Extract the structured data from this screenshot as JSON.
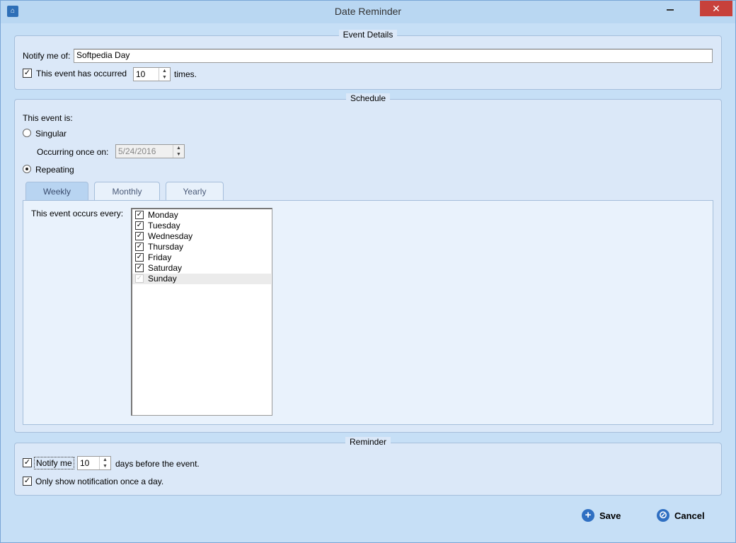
{
  "window": {
    "title": "Date Reminder"
  },
  "event_details": {
    "heading": "Event Details",
    "notify_label": "Notify me of:",
    "notify_value": "Softpedia Day",
    "occurred_label": "This event has occurred",
    "occurred_checked": true,
    "occurred_count": "10",
    "times_label": "times."
  },
  "schedule": {
    "heading": "Schedule",
    "event_is_label": "This event is:",
    "singular_label": "Singular",
    "occurring_label": "Occurring once on:",
    "occurring_date": "5/24/2016",
    "repeating_label": "Repeating",
    "selected_mode": "Repeating",
    "tabs": [
      {
        "label": "Weekly",
        "active": true
      },
      {
        "label": "Monthly",
        "active": false
      },
      {
        "label": "Yearly",
        "active": false
      }
    ],
    "occurs_every_label": "This event occurs every:",
    "days": [
      {
        "label": "Monday",
        "checked": true
      },
      {
        "label": "Tuesday",
        "checked": true
      },
      {
        "label": "Wednesday",
        "checked": true
      },
      {
        "label": "Thursday",
        "checked": true
      },
      {
        "label": "Friday",
        "checked": true
      },
      {
        "label": "Saturday",
        "checked": true
      },
      {
        "label": "Sunday",
        "checked": false
      }
    ]
  },
  "reminder": {
    "heading": "Reminder",
    "notify_me_label": "Notify me",
    "notify_me_checked": true,
    "days_value": "10",
    "days_before_label": "days before the event.",
    "once_a_day_label": "Only show notification once a day.",
    "once_a_day_checked": true
  },
  "buttons": {
    "save_label": "Save",
    "cancel_label": "Cancel"
  }
}
